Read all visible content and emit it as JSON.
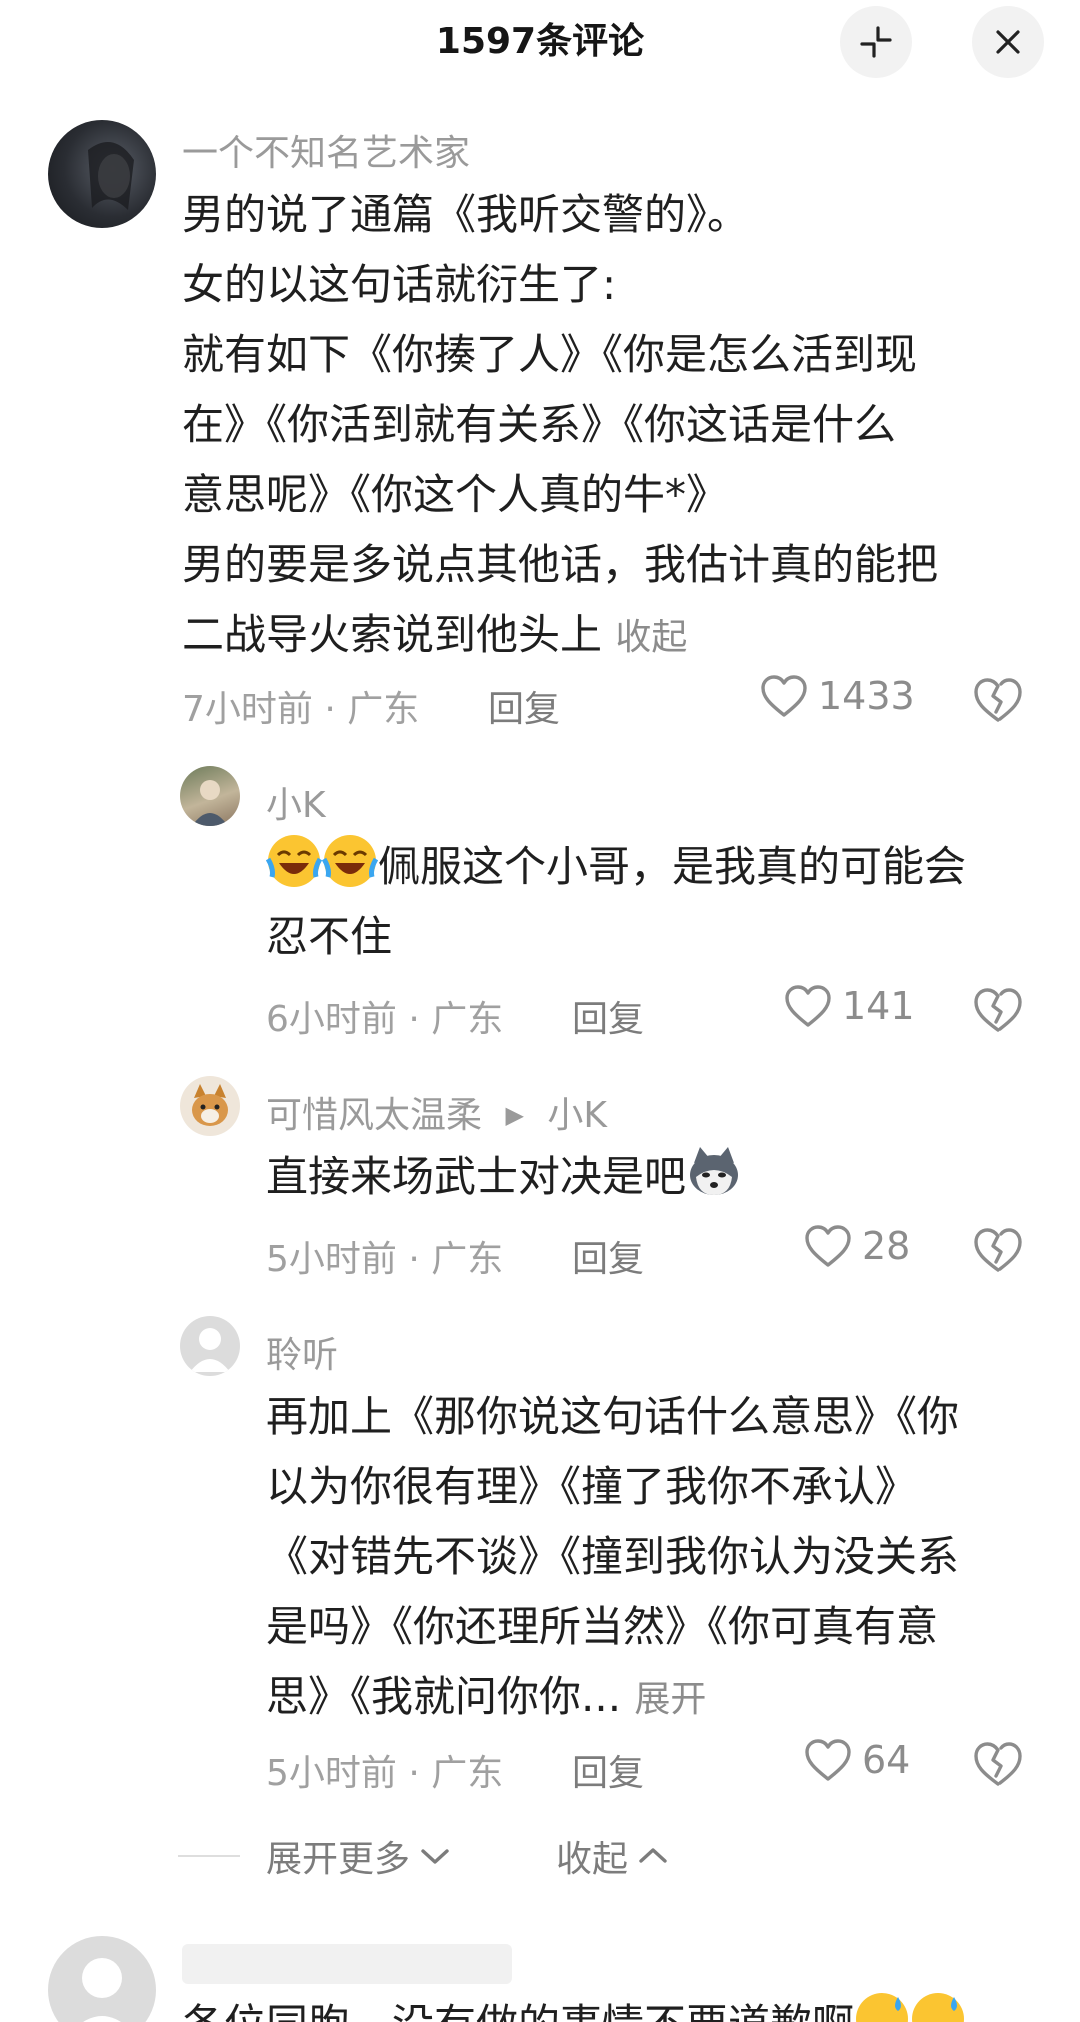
{
  "header": {
    "title": "1597条评论"
  },
  "comments": [
    {
      "user": "一个不知名艺术家",
      "lines": [
        "男的说了通篇《我听交警的》。",
        "女的以这句话就衍生了:",
        "就有如下《你揍了人》《你是怎么活到现",
        "在》《你活到就有关系》《你这话是什么",
        "意思呢》《你这个人真的牛*》",
        "男的要是多说点其他话，我估计真的能把",
        "二战导火索说到他头上"
      ],
      "toggle": "收起",
      "time": "7小时前",
      "location": "广东",
      "reply": "回复",
      "likes": "1433"
    }
  ],
  "replies": [
    {
      "user": "小K",
      "lines": [
        "佩服这个小哥，是我真的可能会",
        "忍不住"
      ],
      "emoji": [
        "laugh-cry-emoji",
        "laugh-cry-emoji"
      ],
      "time": "6小时前",
      "location": "广东",
      "reply": "回复",
      "likes": "141"
    },
    {
      "user": "可惜风太温柔",
      "reply_to": "小K",
      "lines": [
        "直接来场武士对决是吧"
      ],
      "emoji": [
        "husky-emoji"
      ],
      "time": "5小时前",
      "location": "广东",
      "reply": "回复",
      "likes": "28"
    },
    {
      "user": "聆听",
      "lines": [
        "再加上《那你说这句话什么意思》《你",
        "以为你很有理》《撞了我你不承认》",
        "《对错先不谈》《撞到我你认为没关系",
        "是吗》《你还理所当然》《你可真有意",
        "思》《我就问你你..."
      ],
      "toggle": "展开",
      "time": "5小时前",
      "location": "广东",
      "reply": "回复",
      "likes": "64"
    }
  ],
  "footer": {
    "expand_more": "展开更多",
    "collapse": "收起"
  },
  "next_comment": {
    "partial_text": "各位同胞，没有做的事情不要道歉啊"
  },
  "separator": " · ",
  "colors": {
    "meta": "#a0a0a0",
    "name": "#9a9a9a",
    "text": "#1f1f1f"
  }
}
